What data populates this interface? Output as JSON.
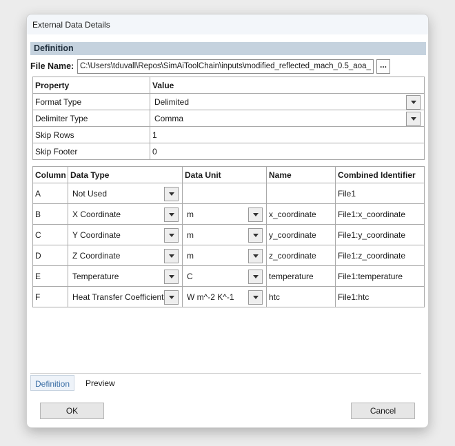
{
  "window": {
    "title": "External Data Details"
  },
  "definition": {
    "section_title": "Definition",
    "file_name_label": "File Name:",
    "file_name_value": "C:\\Users\\tduvall\\Repos\\SimAiToolChain\\inputs\\modified_reflected_mach_0.5_aoa_",
    "browse_label": "..."
  },
  "properties": {
    "headers": {
      "property": "Property",
      "value": "Value"
    },
    "rows": [
      {
        "property": "Format Type",
        "value": "Delimited"
      },
      {
        "property": "Delimiter Type",
        "value": "Comma"
      },
      {
        "property": "Skip Rows",
        "value": "1"
      },
      {
        "property": "Skip Footer",
        "value": "0"
      }
    ]
  },
  "columns": {
    "headers": {
      "column": "Column",
      "data_type": "Data Type",
      "data_unit": "Data Unit",
      "name": "Name",
      "combined": "Combined Identifier"
    },
    "rows": [
      {
        "column": "A",
        "data_type": "Not Used",
        "data_unit": "",
        "name": "",
        "combined": "File1"
      },
      {
        "column": "B",
        "data_type": "X Coordinate",
        "data_unit": "m",
        "name": "x_coordinate",
        "combined": "File1:x_coordinate"
      },
      {
        "column": "C",
        "data_type": "Y Coordinate",
        "data_unit": "m",
        "name": "y_coordinate",
        "combined": "File1:y_coordinate"
      },
      {
        "column": "D",
        "data_type": "Z Coordinate",
        "data_unit": "m",
        "name": "z_coordinate",
        "combined": "File1:z_coordinate"
      },
      {
        "column": "E",
        "data_type": "Temperature",
        "data_unit": "C",
        "name": "temperature",
        "combined": "File1:temperature"
      },
      {
        "column": "F",
        "data_type": "Heat Transfer Coefficient",
        "data_unit": "W m^-2 K^-1",
        "name": "htc",
        "combined": "File1:htc"
      }
    ]
  },
  "tabs": [
    {
      "label": "Definition",
      "active": true
    },
    {
      "label": "Preview",
      "active": false
    }
  ],
  "buttons": {
    "ok": "OK",
    "cancel": "Cancel"
  },
  "colors": {
    "section_header_bg": "#c5d2de",
    "active_tab_text": "#3a6ea5"
  }
}
